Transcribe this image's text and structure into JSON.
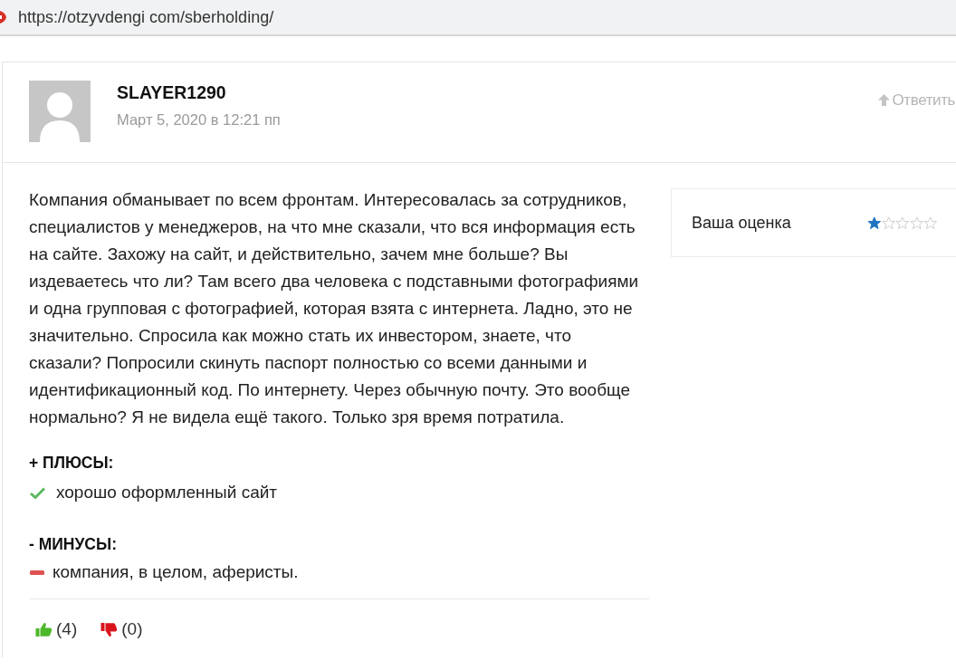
{
  "browser": {
    "url": "https://otzyvdengi com/sberholding/"
  },
  "review": {
    "author": "SLAYER1290",
    "date": "Март 5, 2020 в 12:21 пп",
    "reply_link": "Ответить",
    "text": "Компания обманывает по всем фронтам. Интересовалась за сотрудников, специалистов у менеджеров, на что мне сказали, что вся информация есть на сайте. Захожу на сайт, и действительно, зачем мне больше? Вы издеваетесь что ли? Там всего два человека с подставными фотографиями и одна групповая с фотографией, которая взята с интернета. Ладно, это не значительно. Спросила как можно стать их инвестором, знаете, что сказали? Попросили скинуть паспорт полностью со всеми данными и идентификационный код. По интернету. Через обычную почту. Это вообще нормально? Я не видела ещё такого. Только зря время потратила.",
    "rating": {
      "label": "Ваша оценка",
      "stars": 1
    },
    "pros": {
      "heading": "+ ПЛЮСЫ:",
      "items": [
        "хорошо оформленный сайт"
      ]
    },
    "cons": {
      "heading": "- МИНУСЫ:",
      "items": [
        "компания, в целом, аферисты."
      ]
    },
    "votes": [
      {
        "kind": "up",
        "count": "(4)"
      },
      {
        "kind": "down",
        "count": "(0)"
      }
    ]
  }
}
